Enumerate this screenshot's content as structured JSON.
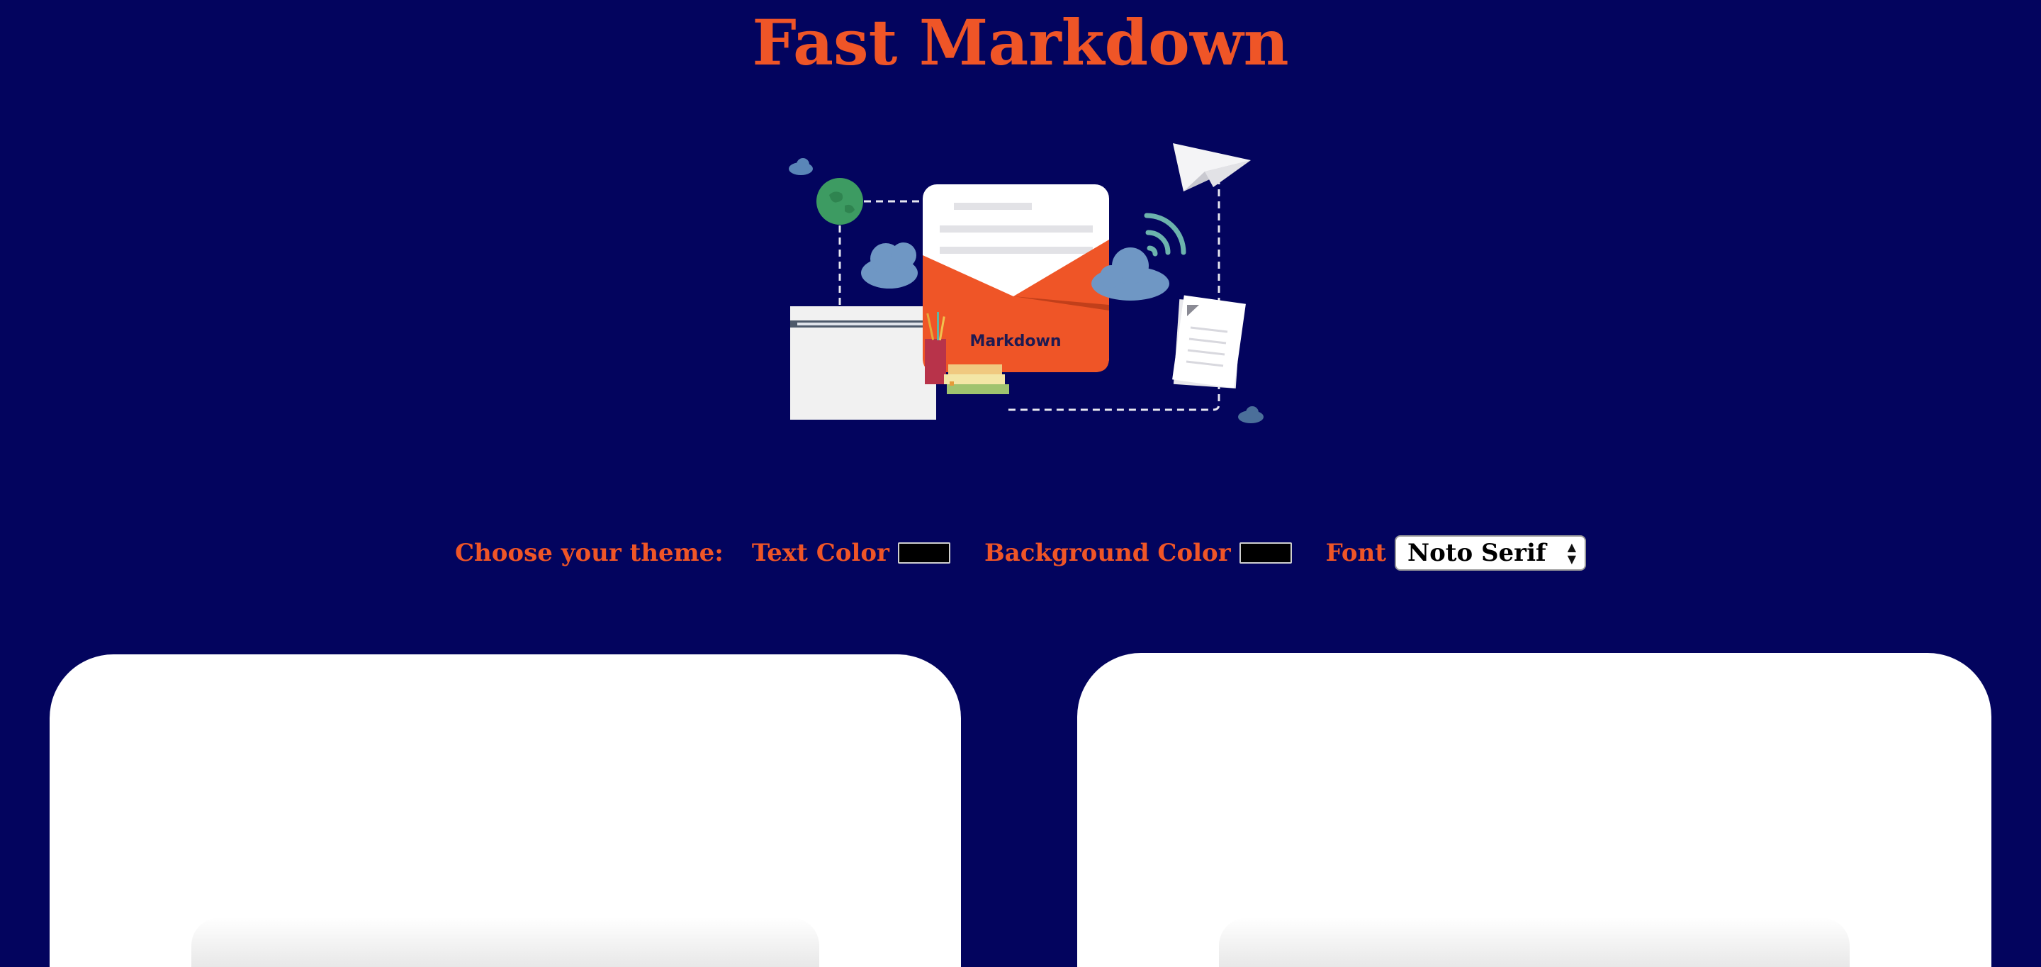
{
  "header": {
    "title": "Fast Markdown"
  },
  "hero": {
    "envelope_label": "Markdown"
  },
  "theme": {
    "heading": "Choose your theme:",
    "text_color_label": "Text Color",
    "text_color_value": "#000000",
    "background_color_label": "Background Color",
    "background_color_value": "#000000",
    "font_label": "Font",
    "font_selected": "Noto Serif"
  },
  "colors": {
    "page_background": "#03045e",
    "accent": "#ef5527",
    "panel_background": "#ffffff"
  },
  "panels": {
    "editor": "",
    "preview": ""
  }
}
